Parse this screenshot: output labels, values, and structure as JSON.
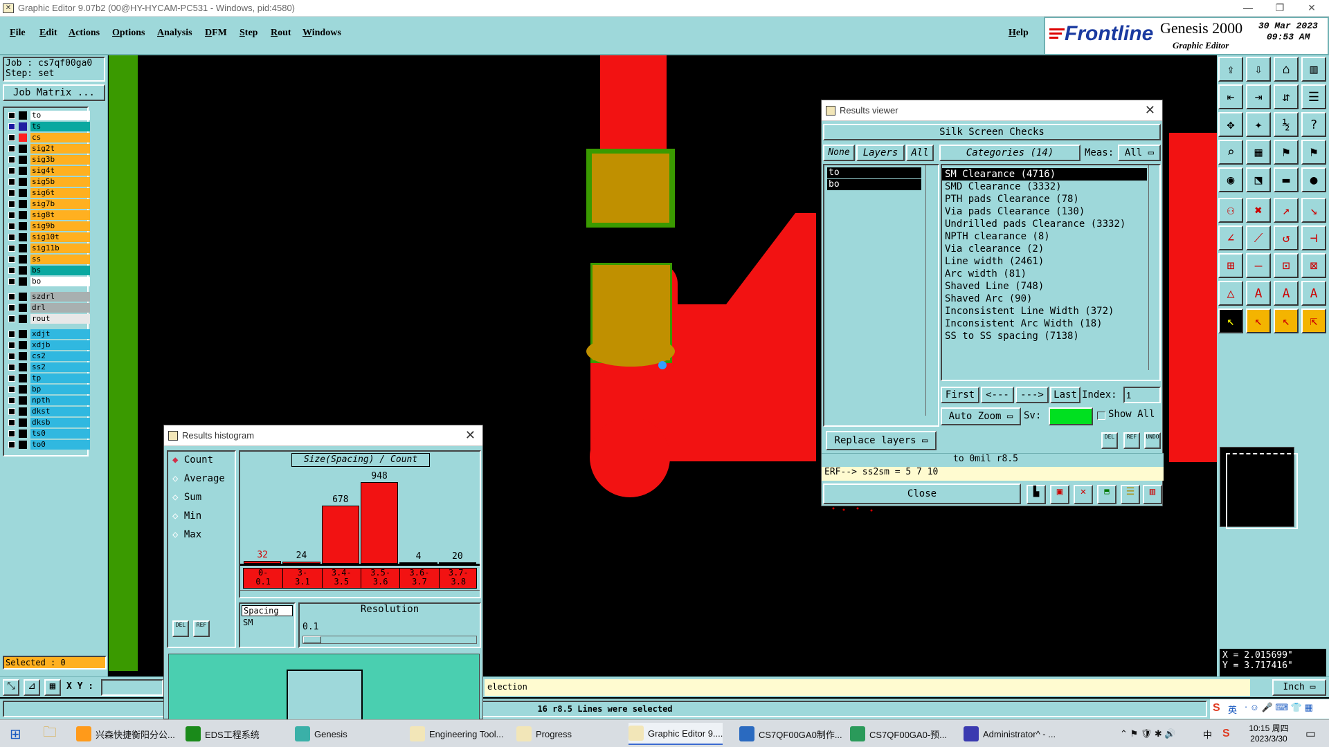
{
  "window": {
    "title": "Graphic Editor 9.07b2 (00@HY-HYCAM-PC531 - Windows, pid:4580)",
    "title_icon": "x-window-icon"
  },
  "menu": {
    "items": [
      "File",
      "Edit",
      "Actions",
      "Options",
      "Analysis",
      "DFM",
      "Step",
      "Rout",
      "Windows"
    ],
    "help": "Help"
  },
  "branding": {
    "logo": "Frontline",
    "product": "Genesis 2000",
    "subtitle": "Graphic Editor",
    "date": "30 Mar 2023",
    "time": "09:53 AM"
  },
  "job": {
    "job_label": "Job : cs7qf00ga0",
    "step_label": "Step: set",
    "matrix_button": "Job Matrix ..."
  },
  "layers": [
    {
      "name": "to",
      "color": "#ffffff",
      "mark": "#000000",
      "sel": false
    },
    {
      "name": "ts",
      "color": "#0aa8a0",
      "mark": "#2020a0",
      "sel": true,
      "note": "n"
    },
    {
      "name": "cs",
      "color": "#ffb020",
      "mark": "#ff2020",
      "sel": false
    },
    {
      "name": "sig2t",
      "color": "#ffb020",
      "mark": "#000000",
      "sel": false
    },
    {
      "name": "sig3b",
      "color": "#ffb020",
      "mark": "#000000",
      "sel": false
    },
    {
      "name": "sig4t",
      "color": "#ffb020",
      "mark": "#000000",
      "sel": false
    },
    {
      "name": "sig5b",
      "color": "#ffb020",
      "mark": "#000000",
      "sel": false
    },
    {
      "name": "sig6t",
      "color": "#ffb020",
      "mark": "#000000",
      "sel": false
    },
    {
      "name": "sig7b",
      "color": "#ffb020",
      "mark": "#000000",
      "sel": false
    },
    {
      "name": "sig8t",
      "color": "#ffb020",
      "mark": "#000000",
      "sel": false
    },
    {
      "name": "sig9b",
      "color": "#ffb020",
      "mark": "#000000",
      "sel": false
    },
    {
      "name": "sig10t",
      "color": "#ffb020",
      "mark": "#000000",
      "sel": false
    },
    {
      "name": "sig11b",
      "color": "#ffb020",
      "mark": "#000000",
      "sel": false
    },
    {
      "name": "ss",
      "color": "#ffb020",
      "mark": "#000000",
      "sel": false
    },
    {
      "name": "bs",
      "color": "#0aa8a0",
      "mark": "#000000",
      "sel": false
    },
    {
      "name": "bo",
      "color": "#ffffff",
      "mark": "#000000",
      "sel": false
    }
  ],
  "layers2": [
    {
      "name": "szdrl",
      "color": "#a8b0b0"
    },
    {
      "name": "drl",
      "color": "#a8b0b0"
    },
    {
      "name": "rout",
      "color": "#e8e8e8"
    }
  ],
  "layers3": [
    {
      "name": "xdjt",
      "color": "#30b8e0"
    },
    {
      "name": "xdjb",
      "color": "#30b8e0"
    },
    {
      "name": "cs2",
      "color": "#30b8e0"
    },
    {
      "name": "ss2",
      "color": "#30b8e0"
    },
    {
      "name": "tp",
      "color": "#30b8e0"
    },
    {
      "name": "bp",
      "color": "#30b8e0"
    },
    {
      "name": "npth",
      "color": "#30b8e0"
    },
    {
      "name": "dkst",
      "color": "#30b8e0"
    },
    {
      "name": "dksb",
      "color": "#30b8e0"
    },
    {
      "name": "ts0",
      "color": "#30b8e0"
    },
    {
      "name": "to0",
      "color": "#30b8e0"
    }
  ],
  "status": {
    "selected": "Selected : 0",
    "xy_label": "X Y :",
    "selection_text": "election",
    "lines_selected": "16 r8.5 Lines were selected",
    "unit": "Inch",
    "coord_x": "X = 2.015699\"",
    "coord_y": "Y = 3.717416\""
  },
  "results_viewer": {
    "title": "Results viewer",
    "section": "Silk Screen Checks",
    "none_btn": "None",
    "layers_btn": "Layers",
    "all_btn": "All",
    "categories_label": "Categories (14)",
    "meas_label": "Meas:",
    "meas_value": "All",
    "layers": [
      "to",
      "bo"
    ],
    "categories": [
      "SM Clearance (4716)",
      "SMD Clearance (3332)",
      "PTH pads Clearance (78)",
      "Via pads Clearance (130)",
      "Undrilled pads Clearance (3332)",
      "NPTH clearance (8)",
      "Via clearance (2)",
      "Line width (2461)",
      "Arc width (81)",
      "Shaved Line (748)",
      "Shaved Arc (90)",
      "Inconsistent Line Width (372)",
      "Inconsistent Arc Width (18)",
      "SS to SS spacing (7138)"
    ],
    "first": "First",
    "prev": "<---",
    "next": "--->",
    "last": "Last",
    "index_label": "Index:",
    "index_value": "1",
    "auto_zoom": "Auto Zoom",
    "sv_label": "Sv:",
    "show_all": "Show All",
    "replace_layers": "Replace layers",
    "info_line": "to  0mil   r8.5",
    "erf_line": "ERF--> ss2sm = 5 7 10",
    "close": "Close",
    "small_btns": [
      "DEL",
      "REF",
      "UNDO"
    ]
  },
  "histogram": {
    "title": "Results histogram",
    "modes": [
      "Count",
      "Average",
      "Sum",
      "Min",
      "Max"
    ],
    "chart_title": "Size(Spacing) / Count",
    "spacing_label": "Spacing",
    "sm_label": "SM",
    "resolution_label": "Resolution",
    "resolution_value": "0.1",
    "small_btns": [
      "DEL",
      "REF"
    ]
  },
  "chart_data": {
    "type": "bar",
    "title": "Size(Spacing) / Count",
    "categories": [
      "0-0.1",
      "3-3.1",
      "3.4-3.5",
      "3.5-3.6",
      "3.6-3.7",
      "3.7-3.8"
    ],
    "bin_labels": [
      [
        "0-",
        "0.1"
      ],
      [
        "3-",
        "3.1"
      ],
      [
        "3.4-",
        "3.5"
      ],
      [
        "3.5-",
        "3.6"
      ],
      [
        "3.6-",
        "3.7"
      ],
      [
        "3.7-",
        "3.8"
      ]
    ],
    "values": [
      32,
      24,
      678,
      948,
      4,
      20
    ],
    "value_colors": [
      "#d00000",
      "#000000",
      "#000000",
      "#000000",
      "#000000",
      "#000000"
    ],
    "ylim": [
      0,
      948
    ],
    "bar_color": "#f21212"
  },
  "taskbar": {
    "items": [
      {
        "label": "兴森快捷衡阳分公...",
        "icon": "#ff9a1a"
      },
      {
        "label": "EDS工程系统",
        "icon": "#1a8a1a"
      },
      {
        "label": "Genesis",
        "icon": "#3ab0a8"
      },
      {
        "label": "Engineering Tool...",
        "icon": "#f2e6b8"
      },
      {
        "label": "Progress",
        "icon": "#f2e6b8"
      },
      {
        "label": "Graphic Editor 9....",
        "icon": "#f2e6b8"
      },
      {
        "label": "CS7QF00GA0制作...",
        "icon": "#2a6ac0"
      },
      {
        "label": "CS7QF00GA0-预...",
        "icon": "#2a9a5a"
      },
      {
        "label": "Administrator^ - ...",
        "icon": "#3a3ab0"
      }
    ],
    "clock_time": "10:15 周四",
    "clock_date": "2023/3/30",
    "ime": "中",
    "ime2": "英"
  },
  "colors": {
    "panel": "#9ed8da",
    "accent_red": "#f21212",
    "board_green": "#3a9a00",
    "copper": "#c09000"
  }
}
